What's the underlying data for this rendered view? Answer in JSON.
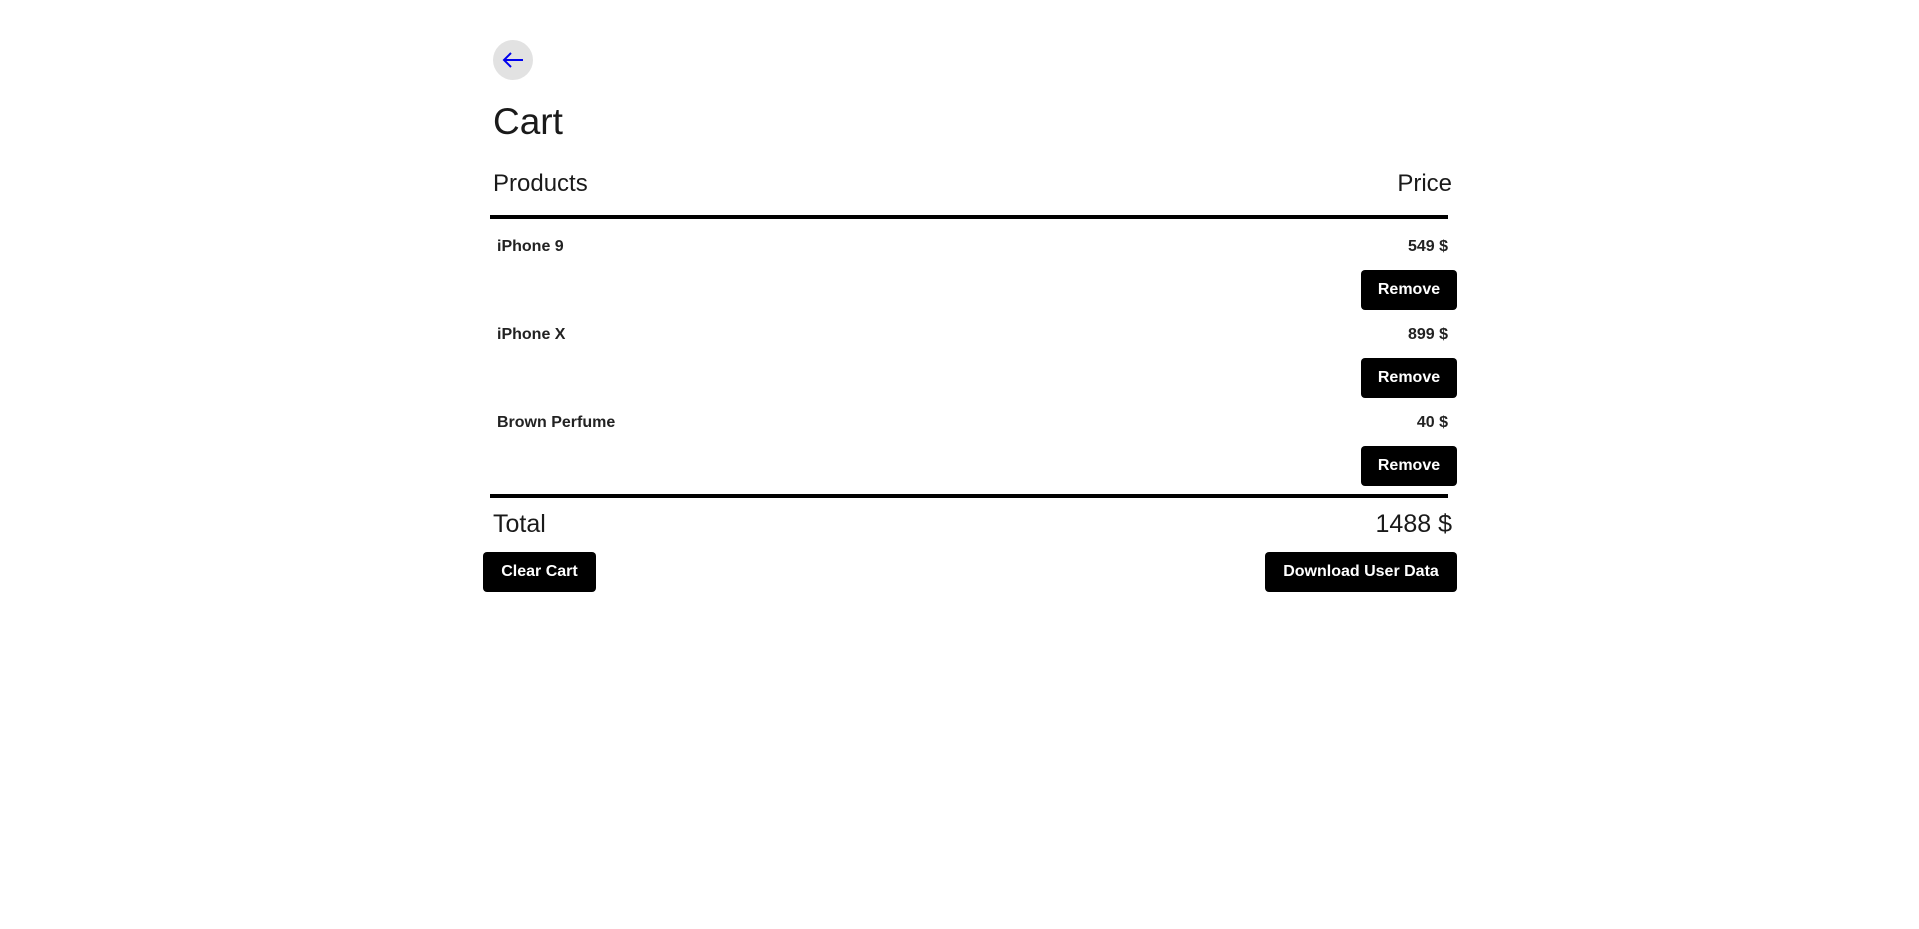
{
  "nav": {
    "back_icon": "arrow-left-icon",
    "back_icon_color": "#0000ee"
  },
  "page": {
    "title": "Cart"
  },
  "table": {
    "headers": {
      "products": "Products",
      "price": "Price"
    },
    "items": [
      {
        "name": "iPhone 9",
        "price": "549 $",
        "remove_label": "Remove"
      },
      {
        "name": "iPhone X",
        "price": "899 $",
        "remove_label": "Remove"
      },
      {
        "name": "Brown Perfume",
        "price": "40 $",
        "remove_label": "Remove"
      }
    ]
  },
  "summary": {
    "total_label": "Total",
    "total_value": "1488 $"
  },
  "actions": {
    "clear_label": "Clear Cart",
    "download_label": "Download User Data"
  },
  "colors": {
    "button_bg": "#000000",
    "button_text": "#ffffff",
    "back_button_bg": "#e2e2e2"
  }
}
